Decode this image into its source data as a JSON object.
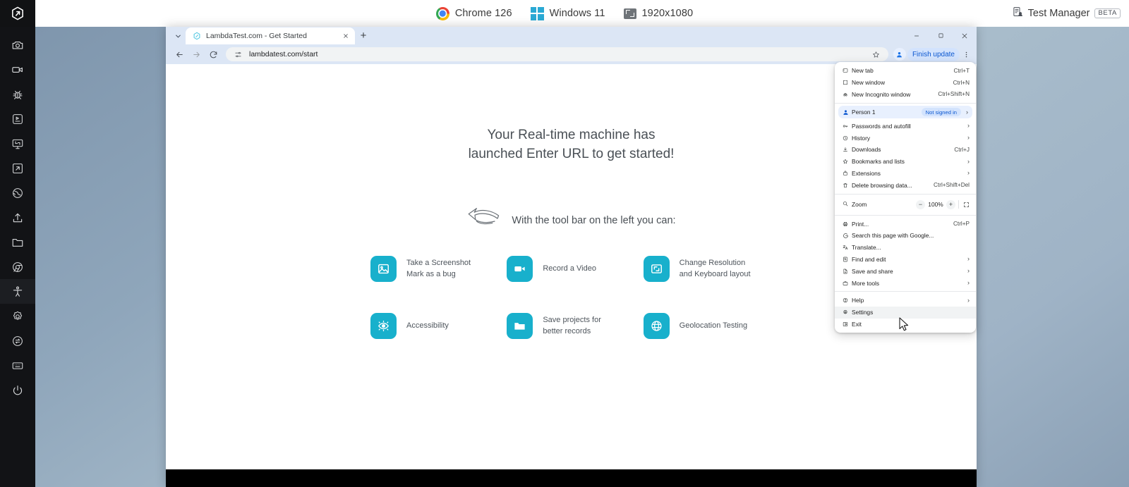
{
  "topbar": {
    "brand_icon": "lambdatest-logo-icon",
    "items": [
      {
        "icon": "chrome-logo-icon",
        "label": "Chrome 126"
      },
      {
        "icon": "windows-logo-icon",
        "label": "Windows 11"
      },
      {
        "icon": "resolution-icon",
        "label": "1920x1080"
      }
    ],
    "right": {
      "icon": "test-manager-icon",
      "label": "Test Manager",
      "badge": "BETA"
    }
  },
  "rail": {
    "items": [
      {
        "name": "camera-icon",
        "label": "Take Screenshot"
      },
      {
        "name": "video-camera-icon",
        "label": "Record Video"
      },
      {
        "name": "bug-icon",
        "label": "Mark as Bug"
      },
      {
        "name": "issue-tracker-icon",
        "label": "Issue Tracker"
      },
      {
        "name": "monitor-resolution-icon",
        "label": "Change Resolution"
      },
      {
        "name": "external-link-icon",
        "label": "Open in new tab"
      },
      {
        "name": "globe-icon",
        "label": "Geolocation"
      },
      {
        "name": "upload-icon",
        "label": "Upload"
      },
      {
        "name": "folder-icon",
        "label": "Projects"
      },
      {
        "name": "chrome-browser-icon",
        "label": "Browser"
      },
      {
        "name": "accessibility-icon",
        "label": "Accessibility"
      },
      {
        "name": "gear-icon",
        "label": "Settings"
      },
      {
        "name": "switch-icon",
        "label": "Switch Browser"
      },
      {
        "name": "keyboard-icon",
        "label": "Keyboard"
      },
      {
        "name": "power-icon",
        "label": "Stop Session"
      }
    ]
  },
  "browser": {
    "tab": {
      "title": "LambdaTest.com - Get Started",
      "favicon": "lambdatest-favicon-icon"
    },
    "new_tab_label": "+",
    "window_controls": {
      "minimize": "minimize-icon",
      "maximize": "maximize-icon",
      "close": "close-icon"
    },
    "toolbar": {
      "back": "back-arrow-icon",
      "forward": "forward-arrow-icon",
      "reload": "reload-icon",
      "site_info": "site-settings-icon",
      "url": "lambdatest.com/start",
      "bookmark": "star-icon",
      "profile": "profile-avatar-icon",
      "finish_update": "Finish update",
      "menu": "kebab-menu-icon"
    }
  },
  "page": {
    "hero_line1": "Your Real-time machine has",
    "hero_line2": "launched Enter URL to get started!",
    "subtitle": "With the tool bar on the left you can:",
    "arrow_icon": "hand-drawn-arrow-icon",
    "features": [
      {
        "icon": "screenshot-icon",
        "line1": "Take a Screenshot",
        "line2": "Mark as a bug"
      },
      {
        "icon": "video-icon",
        "line1": "Record a Video",
        "line2": ""
      },
      {
        "icon": "resolution-icon",
        "line1": "Change Resolution",
        "line2": "and Keyboard layout"
      },
      {
        "icon": "eye-accessibility-icon",
        "line1": "Accessibility",
        "line2": ""
      },
      {
        "icon": "folder-icon",
        "line1": "Save projects for",
        "line2": "better records"
      },
      {
        "icon": "globe-icon",
        "line1": "Geolocation Testing",
        "line2": ""
      }
    ],
    "accent_color": "#18b0cc"
  },
  "chrome_menu": {
    "groups": [
      {
        "items": [
          {
            "icon": "new-tab-icon",
            "label": "New tab",
            "shortcut": "Ctrl+T",
            "chevron": false
          },
          {
            "icon": "new-window-icon",
            "label": "New window",
            "shortcut": "Ctrl+N",
            "chevron": false
          },
          {
            "icon": "incognito-icon",
            "label": "New Incognito window",
            "shortcut": "Ctrl+Shift+N",
            "chevron": false
          }
        ]
      },
      {
        "profile": {
          "icon": "person-icon",
          "label": "Person 1",
          "status": "Not signed in",
          "chevron": true
        },
        "items": [
          {
            "icon": "key-icon",
            "label": "Passwords and autofill",
            "shortcut": "",
            "chevron": true
          },
          {
            "icon": "history-icon",
            "label": "History",
            "shortcut": "",
            "chevron": true
          },
          {
            "icon": "download-icon",
            "label": "Downloads",
            "shortcut": "Ctrl+J",
            "chevron": false
          },
          {
            "icon": "star-icon",
            "label": "Bookmarks and lists",
            "shortcut": "",
            "chevron": true
          },
          {
            "icon": "extensions-icon",
            "label": "Extensions",
            "shortcut": "",
            "chevron": true
          },
          {
            "icon": "trash-icon",
            "label": "Delete browsing data...",
            "shortcut": "Ctrl+Shift+Del",
            "chevron": false
          }
        ]
      }
    ],
    "zoom_row": {
      "icon": "magnifier-icon",
      "label": "Zoom",
      "minus": "−",
      "value": "100%",
      "plus": "+",
      "fullscreen": "fullscreen-icon"
    },
    "group3": [
      {
        "icon": "printer-icon",
        "label": "Print...",
        "shortcut": "Ctrl+P",
        "chevron": false
      },
      {
        "icon": "google-g-icon",
        "label": "Search this page with Google...",
        "shortcut": "",
        "chevron": false
      },
      {
        "icon": "translate-icon",
        "label": "Translate...",
        "shortcut": "",
        "chevron": false
      },
      {
        "icon": "find-edit-icon",
        "label": "Find and edit",
        "shortcut": "",
        "chevron": true
      },
      {
        "icon": "save-share-icon",
        "label": "Save and share",
        "shortcut": "",
        "chevron": true
      },
      {
        "icon": "more-tools-icon",
        "label": "More tools",
        "shortcut": "",
        "chevron": true
      }
    ],
    "group4": [
      {
        "icon": "help-icon",
        "label": "Help",
        "shortcut": "",
        "chevron": true,
        "highlight": false
      },
      {
        "icon": "settings-gear-icon",
        "label": "Settings",
        "shortcut": "",
        "chevron": false,
        "highlight": true
      },
      {
        "icon": "exit-icon",
        "label": "Exit",
        "shortcut": "",
        "chevron": false,
        "highlight": false
      }
    ]
  }
}
